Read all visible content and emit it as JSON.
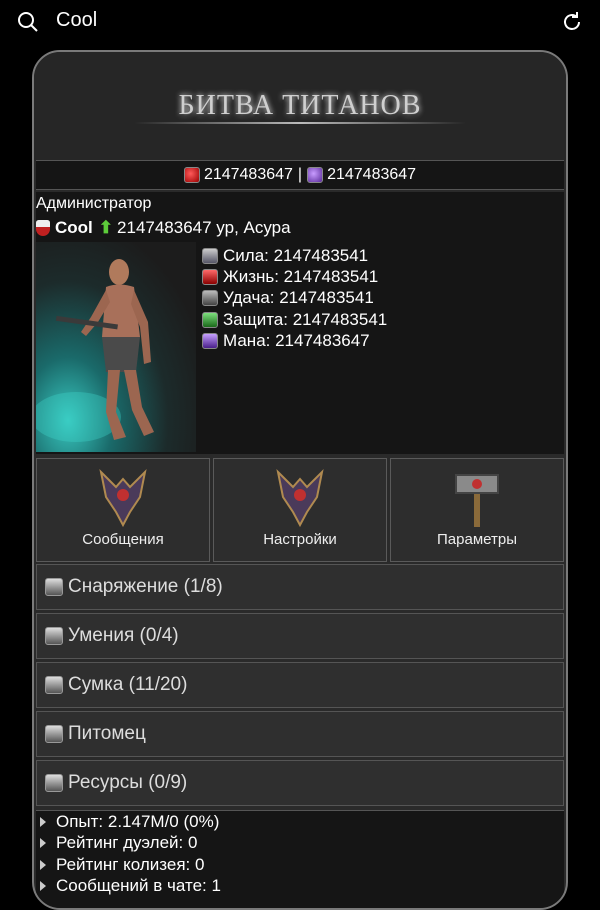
{
  "browser": {
    "query": "Cool"
  },
  "game": {
    "logo": "БИТВА ТИТАНОВ"
  },
  "currency": {
    "red_gems": "2147483647",
    "separator": "|",
    "purple_gems": "2147483647"
  },
  "player": {
    "role": "Администратор",
    "name": "Cool",
    "level_text": "2147483647 ур, Асура"
  },
  "stats": [
    {
      "label": "Сила: 2147483541",
      "icon": "strength-icon"
    },
    {
      "label": "Жизнь: 2147483541",
      "icon": "life-icon"
    },
    {
      "label": "Удача: 2147483541",
      "icon": "luck-icon"
    },
    {
      "label": "Защита: 2147483541",
      "icon": "defense-icon"
    },
    {
      "label": "Мана: 2147483647",
      "icon": "mana-icon"
    }
  ],
  "tiles": {
    "messages": "Сообщения",
    "settings": "Настройки",
    "parameters": "Параметры"
  },
  "menu": {
    "equipment": "Снаряжение (1/8)",
    "skills": "Умения (0/4)",
    "bag": "Сумка (11/20)",
    "pet": "Питомец",
    "resources": "Ресурсы (0/9)"
  },
  "info": [
    "Опыт: 2.147M/0 (0%)",
    "Рейтинг дуэлей: 0",
    "Рейтинг колизея: 0",
    "Сообщений в чате: 1"
  ],
  "colors": {
    "accent_green": "#5dcc3a",
    "gem_red": "#c00000",
    "gem_purple": "#7a40c8"
  }
}
